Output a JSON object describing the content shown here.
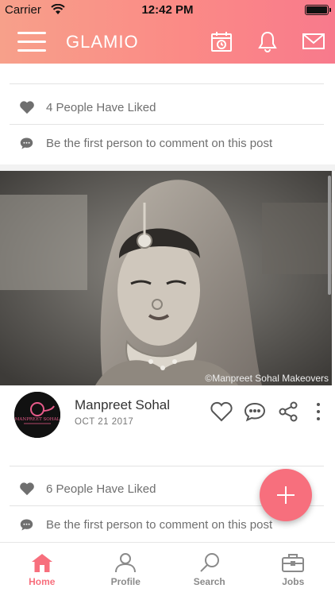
{
  "status_bar": {
    "carrier": "Carrier",
    "time": "12:42 PM"
  },
  "header": {
    "title": "GLAMIO",
    "icons": [
      "menu-icon",
      "calendar-icon",
      "bell-icon",
      "mail-icon"
    ]
  },
  "posts": [
    {
      "likes_text": "4 People Have Liked",
      "comment_text": "Be the first person to comment on this post"
    },
    {
      "photo_credit": "©Manpreet Sohal Makeovers",
      "author_name": "Manpreet Sohal",
      "date": "OCT 21 2017",
      "avatar_text": "MANPREET SOHAL",
      "likes_text": "6 People Have Liked",
      "comment_text": "Be the first person to comment on this post"
    }
  ],
  "tabbar": {
    "tabs": [
      {
        "label": "Home",
        "icon": "home-icon",
        "active": true
      },
      {
        "label": "Profile",
        "icon": "profile-icon",
        "active": false
      },
      {
        "label": "Search",
        "icon": "search-icon",
        "active": false
      },
      {
        "label": "Jobs",
        "icon": "briefcase-icon",
        "active": false
      }
    ]
  },
  "colors": {
    "accent": "#f76f7d",
    "header_start": "#f7a08a",
    "header_end": "#f87a8c"
  }
}
